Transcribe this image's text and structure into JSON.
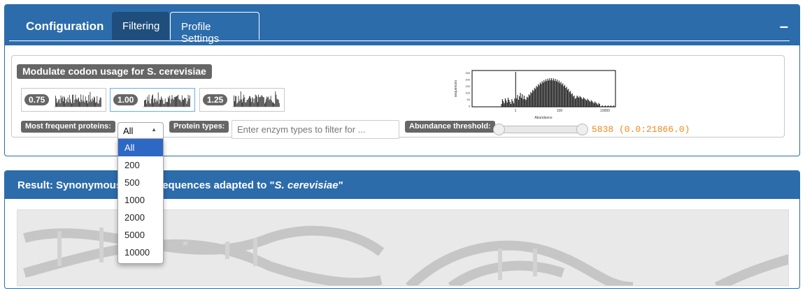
{
  "config": {
    "title": "Configuration",
    "tabs": [
      {
        "label": "Filtering"
      },
      {
        "label": "Profile Settings"
      }
    ],
    "collapse_glyph": "–",
    "modulate_label": "Modulate codon usage for S. cerevisiae",
    "modulation_options": [
      "0.75",
      "1.00",
      "1.25"
    ],
    "selected_modulation": "1.00",
    "most_frequent_label": "Most frequent proteins:",
    "most_frequent_selected": "All",
    "most_frequent_options": [
      "All",
      "200",
      "500",
      "1000",
      "2000",
      "5000",
      "10000"
    ],
    "protein_types_label": "Protein types:",
    "protein_types_placeholder": "Enter enzym types to filter for ...",
    "abundance_label": "Abundance threshold:",
    "abundance_value_text": "5838 (0.0:21866.0)",
    "histogram": {
      "ylabel": "sequences",
      "xlabel": "Abundance",
      "y_ticks": [
        "250",
        "200",
        "150",
        "100",
        "50",
        "0"
      ],
      "x_ticks": [
        "1",
        "100",
        "10000"
      ]
    },
    "colors": {
      "header": "#2c6cab",
      "active_tab": "#1f4e7c",
      "threshold_text": "#f0891a"
    }
  },
  "result": {
    "title_prefix": "Result: Synonymous",
    "title_hidden_part": " sequences adapted to ",
    "title_middle": "equences adapted to \"",
    "title_species": "S. cerevisiae",
    "title_suffix": "\""
  }
}
